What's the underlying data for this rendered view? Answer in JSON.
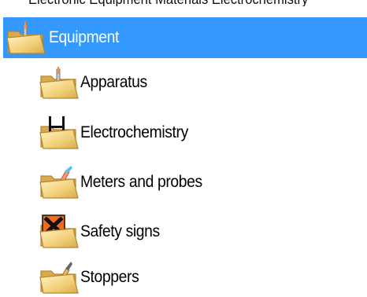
{
  "partial_row": {
    "text": "Electronic Equipment Materials Electrochemistry"
  },
  "tree": {
    "root": {
      "label": "Equipment",
      "icon": "folder-apparatus-icon",
      "selected": true
    },
    "children": [
      {
        "label": "Apparatus",
        "icon": "folder-apparatus-icon"
      },
      {
        "label": "Electrochemistry",
        "icon": "folder-electrochemistry-icon"
      },
      {
        "label": "Meters and probes",
        "icon": "folder-meters-icon"
      },
      {
        "label": "Safety signs",
        "icon": "folder-safety-sign-icon"
      },
      {
        "label": "Stoppers",
        "icon": "folder-stoppers-icon"
      }
    ]
  },
  "colors": {
    "selection": "#3399ff",
    "folder": "#f3d27e",
    "folder_dark": "#c99a34"
  }
}
